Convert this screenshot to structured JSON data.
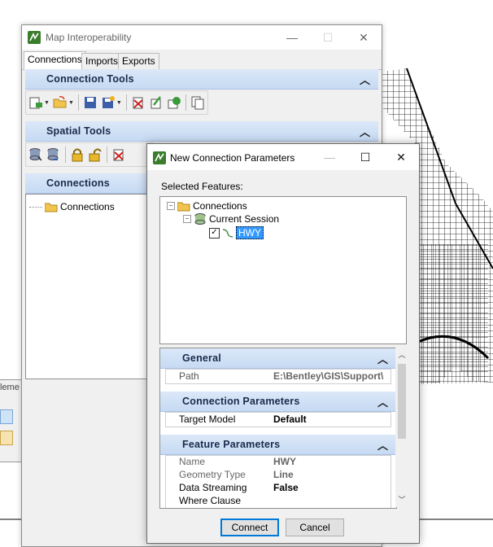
{
  "main_window": {
    "title": "Map Interoperability",
    "tabs": [
      "Connections",
      "Imports",
      "Exports"
    ],
    "sections": {
      "connection_tools": "Connection Tools",
      "spatial_tools": "Spatial Tools",
      "connections": "Connections"
    },
    "tree": {
      "root": "Connections"
    },
    "controls": {
      "minimize": "—",
      "maximize": "☐",
      "close": "✕"
    }
  },
  "left_panel": {
    "title": "leme"
  },
  "dialog": {
    "title": "New Connection Parameters",
    "controls": {
      "minimize": "—",
      "maximize": "☐",
      "close": "✕"
    },
    "selected_label": "Selected Features:",
    "tree": {
      "root": "Connections",
      "session": "Current Session",
      "feature": "HWY",
      "feature_checked": true
    },
    "general": {
      "title": "General",
      "rows": [
        {
          "key": "Path",
          "value": "E:\\Bentley\\GIS\\Support\\"
        }
      ]
    },
    "connection_parameters": {
      "title": "Connection Parameters",
      "rows": [
        {
          "key": "Target Model",
          "value": "Default"
        }
      ]
    },
    "feature_parameters": {
      "title": "Feature Parameters",
      "rows": [
        {
          "key": "Name",
          "value": "HWY"
        },
        {
          "key": "Geometry Type",
          "value": "Line"
        },
        {
          "key": "Data Streaming",
          "value": "False"
        },
        {
          "key": "Where Clause",
          "value": ""
        }
      ]
    },
    "buttons": {
      "connect": "Connect",
      "cancel": "Cancel"
    }
  },
  "colors": {
    "section_header": "#c6daf3",
    "section_text": "#1a2b4c",
    "selection": "#3399ff",
    "primary_border": "#0078d7"
  }
}
